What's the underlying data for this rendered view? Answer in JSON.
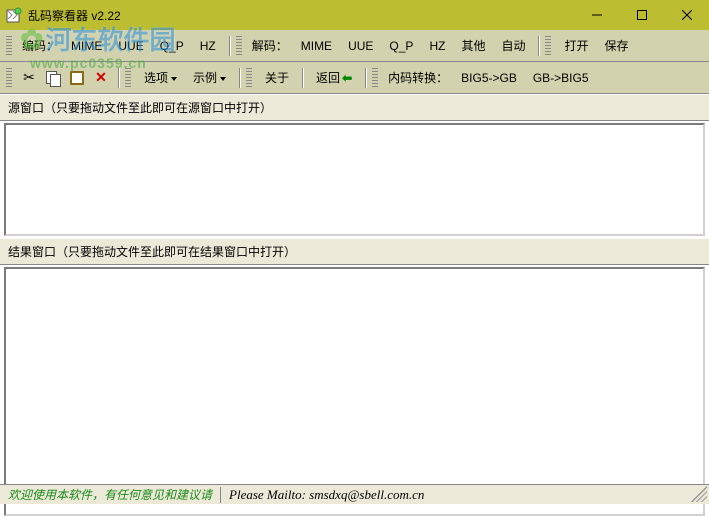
{
  "window": {
    "title": "乱码察看器 v2.22"
  },
  "toolbar1": {
    "encode_label": "编码：",
    "mime": "MIME",
    "uue": "UUE",
    "qp": "Q_P",
    "hz": "HZ",
    "decode_label": "解码：",
    "d_mime": "MIME",
    "d_uue": "UUE",
    "d_qp": "Q_P",
    "d_hz": "HZ",
    "other": "其他",
    "auto": "自动",
    "open": "打开",
    "save": "保存"
  },
  "toolbar2": {
    "options": "选项",
    "examples": "示例",
    "about": "关于",
    "return": "返回",
    "codepage_label": "内码转换：",
    "big5_gb": "BIG5->GB",
    "gb_big5": "GB->BIG5"
  },
  "panes": {
    "source_label": "源窗口（只要拖动文件至此即可在源窗口中打开）",
    "result_label": "结果窗口（只要拖动文件至此即可在结果窗口中打开）",
    "source_value": ""
  },
  "status": {
    "welcome": "欢迎使用本软件，有任何意见和建议请",
    "mailto": "Please Mailto: smsdxq@sbell.com.cn"
  },
  "watermark": {
    "brand": "河东软件园",
    "url": "www.pc0359.cn"
  }
}
